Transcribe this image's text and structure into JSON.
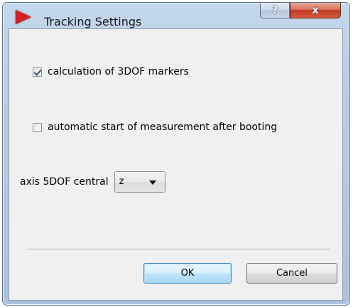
{
  "window": {
    "title": "Tracking Settings",
    "help_label": "?",
    "close_label": "x"
  },
  "options": {
    "calc_3dof": {
      "label": "calculation of 3DOF markers",
      "checked": true
    },
    "auto_start": {
      "label": "automatic start of measurement after booting",
      "checked": false
    }
  },
  "axis": {
    "label": "axis 5DOF central",
    "selected": "z"
  },
  "buttons": {
    "ok": "OK",
    "cancel": "Cancel"
  },
  "colors": {
    "frame": "#b6cde5",
    "close": "#c13b22",
    "app_icon": "#d42020",
    "client_bg": "#f0f0f0",
    "default_button": "#bee6fd"
  },
  "icons": {
    "app": "red-play-triangle-icon",
    "help": "question-mark-icon",
    "close": "close-x-icon",
    "dropdown": "chevron-down-icon"
  }
}
